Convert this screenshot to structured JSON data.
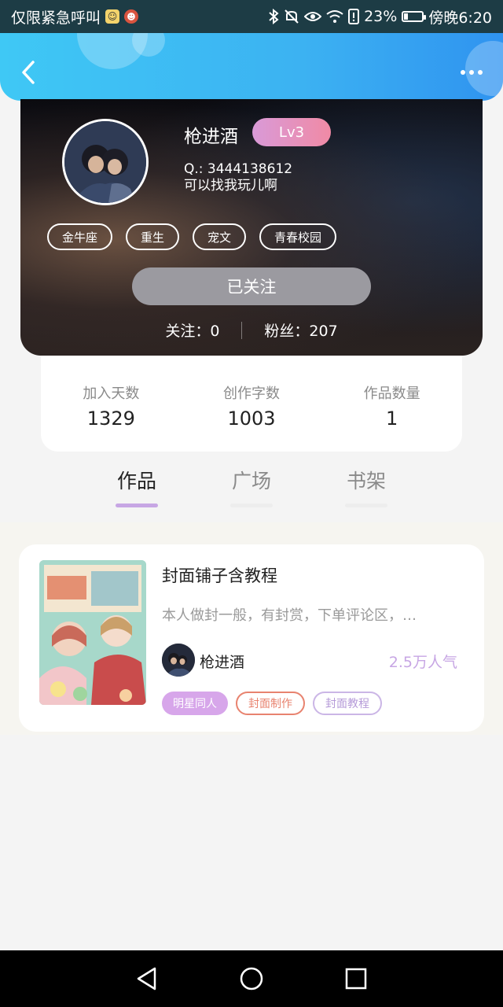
{
  "status_bar": {
    "carrier": "仅限紧急呼叫",
    "battery_percent": "23%",
    "battery_level": 0.23,
    "time": "傍晚6:20",
    "icons": [
      "bluetooth-icon",
      "mute-icon",
      "eye-icon",
      "wifi-icon",
      "alert-icon",
      "battery-icon"
    ]
  },
  "header": {
    "back_icon": "chevron-left-icon",
    "more_icon": "more-dots-icon",
    "accent_color": "#3cb2f2"
  },
  "profile": {
    "username": "枪进酒",
    "level": "Lv3",
    "qq": "Q.: 3444138612",
    "bio": "可以找我玩儿啊",
    "tags": [
      "金牛座",
      "重生",
      "宠文",
      "青春校园"
    ],
    "follow_button": "已关注",
    "following": "关注：0",
    "followers": "粉丝：207"
  },
  "stats": [
    {
      "label": "加入天数",
      "value": "1329"
    },
    {
      "label": "创作字数",
      "value": "1003"
    },
    {
      "label": "作品数量",
      "value": "1"
    }
  ],
  "tabs": [
    {
      "label": "作品",
      "active": true
    },
    {
      "label": "广场",
      "active": false
    },
    {
      "label": "书架",
      "active": false
    }
  ],
  "work": {
    "title": "封面铺子含教程",
    "description": "本人做封一般，有封赏，下单评论区，…",
    "author": "枪进酒",
    "popularity": "2.5万人气",
    "tags": [
      "明星同人",
      "封面制作",
      "封面教程"
    ]
  },
  "navbar": {
    "icons": [
      "back-triangle-icon",
      "home-circle-icon",
      "recents-square-icon"
    ]
  }
}
